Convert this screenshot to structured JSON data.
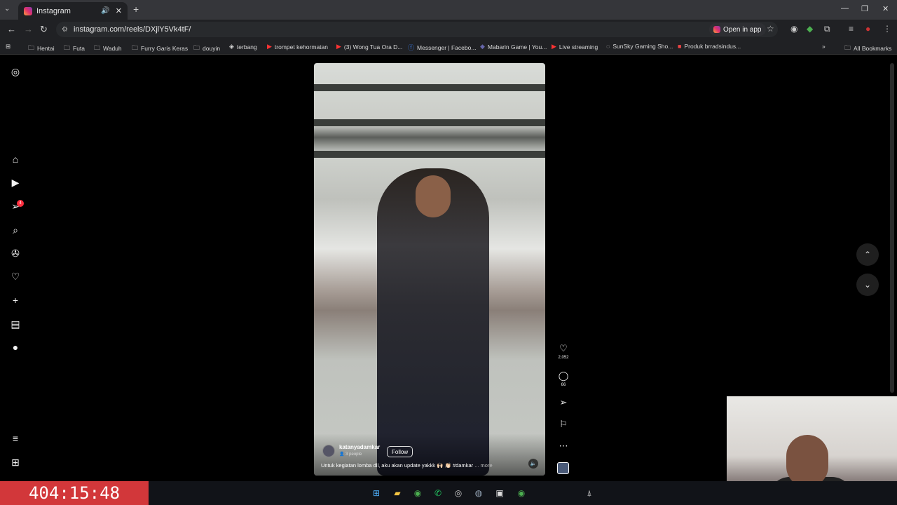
{
  "browser": {
    "tab_title": "Instagram",
    "url": "instagram.com/reels/DXjlY5Vk4tF/",
    "open_in_app": "Open in app",
    "all_bookmarks": "All Bookmarks",
    "bookmarks": [
      {
        "label": "Hentai",
        "icon": "folder-icon"
      },
      {
        "label": "Futa",
        "icon": "folder-icon"
      },
      {
        "label": "Waduh",
        "icon": "folder-icon"
      },
      {
        "label": "Furry Garis Keras",
        "icon": "folder-icon"
      },
      {
        "label": "douyin",
        "icon": "folder-icon"
      },
      {
        "label": "terbang",
        "icon": "site-icon"
      },
      {
        "label": "trompet kehormatan",
        "icon": "youtube-icon"
      },
      {
        "label": "(3) Wong Tua Ora D...",
        "icon": "youtube-icon"
      },
      {
        "label": "Messenger | Facebo...",
        "icon": "facebook-icon"
      },
      {
        "label": "Mabarin Game | You...",
        "icon": "site-icon"
      },
      {
        "label": "Live streaming",
        "icon": "youtube-icon"
      },
      {
        "label": "SunSky Gaming Sho...",
        "icon": "site-icon"
      },
      {
        "label": "Produk brradsindus...",
        "icon": "shop-icon"
      }
    ]
  },
  "sidebar": {
    "notification_count": "4"
  },
  "reel": {
    "username": "katanyadamkar",
    "people": "3 people",
    "follow_label": "Follow",
    "caption": "Untuk kegiatan lomba dll, aku akan update yakkk 🙌🏻 👏🏻 #damkar",
    "more_label": "... more",
    "likes": "2,052",
    "comments": "66"
  },
  "overlay": {
    "timer": "404:15:48"
  }
}
